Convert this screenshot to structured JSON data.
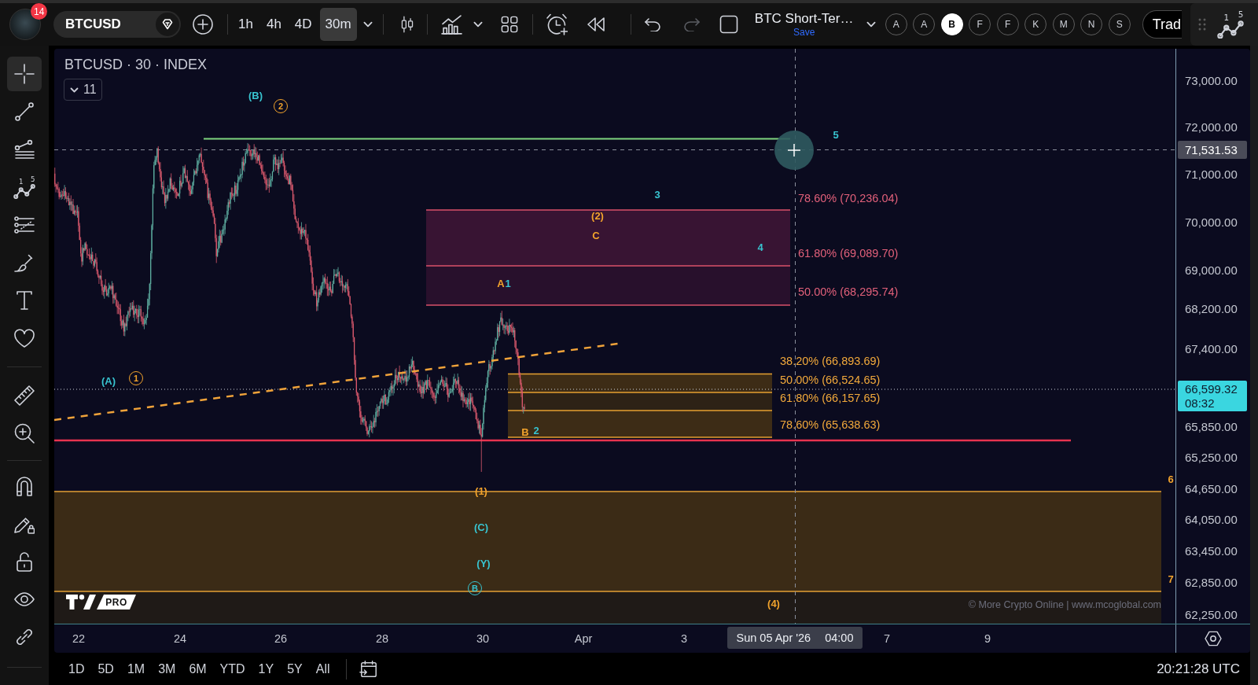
{
  "top_toolbar": {
    "notification_count": "14",
    "symbol": "BTCUSD",
    "intervals": [
      {
        "label": "1h",
        "selected": false
      },
      {
        "label": "4h",
        "selected": false
      },
      {
        "label": "4D",
        "selected": false
      },
      {
        "label": "30m",
        "selected": true
      }
    ],
    "history_buttons": [
      {
        "disabled": false
      },
      {
        "disabled": true
      }
    ],
    "layout_name": "BTC Short-Ter…",
    "save_label": "Save",
    "drawing_lists": [
      {
        "label": "A",
        "selected": false
      },
      {
        "label": "A",
        "selected": false
      },
      {
        "label": "B",
        "selected": true
      },
      {
        "label": "F",
        "selected": false
      },
      {
        "label": "F",
        "selected": false
      },
      {
        "label": "K",
        "selected": false
      },
      {
        "label": "M",
        "selected": false
      },
      {
        "label": "N",
        "selected": false
      },
      {
        "label": "S",
        "selected": false
      }
    ],
    "trade_button": "Trad",
    "wave_tool_digits": [
      "1",
      "5"
    ]
  },
  "left_toolbar": {
    "tools": [
      {
        "selected": true
      },
      {
        "selected": false
      },
      {
        "selected": false
      },
      {
        "selected": false,
        "digits": [
          "1",
          "5"
        ]
      },
      {
        "selected": false
      },
      {
        "selected": false
      },
      {
        "selected": false
      },
      {
        "selected": false
      },
      {
        "selected": false
      },
      {
        "selected": false
      },
      {
        "selected": false
      },
      {
        "selected": false
      },
      {
        "selected": false
      },
      {
        "selected": false
      },
      {
        "selected": false
      }
    ]
  },
  "chart": {
    "title": "BTCUSD · 30 · INDEX",
    "legend_count": "11",
    "fib_levels": [
      {
        "label": "78.60% (70,236.04)",
        "color": "#e2607a"
      },
      {
        "label": "61.80% (69,089.70)",
        "color": "#e2607a"
      },
      {
        "label": "50.00% (68,295.74)",
        "color": "#e2607a"
      },
      {
        "label": "38.20% (66,893.69)",
        "color": "#f2a93b"
      },
      {
        "label": "50.00% (66,524.65)",
        "color": "#f2a93b"
      },
      {
        "label": "61.80% (66,157.65)",
        "color": "#f2a93b"
      },
      {
        "label": "78.60% (65,638.63)",
        "color": "#f2a93b"
      }
    ],
    "wave_labels": [
      {
        "text": "(B)",
        "color": "#38c4d0",
        "circled": false
      },
      {
        "text": "2",
        "color": "#f2a32c",
        "circled": true
      },
      {
        "text": "5",
        "color": "#38c4d0",
        "circled": false
      },
      {
        "text": "3",
        "color": "#38c4d0",
        "circled": false
      },
      {
        "text": "(2)",
        "color": "#f2a32c",
        "circled": false
      },
      {
        "text": "C",
        "color": "#f2a32c",
        "circled": false
      },
      {
        "text": "4",
        "color": "#38c4d0",
        "circled": false
      },
      {
        "text": "A",
        "color": "#f2a32c",
        "circled": false
      },
      {
        "text": "1",
        "color": "#38c4d0",
        "circled": false
      },
      {
        "text": "(A)",
        "color": "#38c4d0",
        "circled": false
      },
      {
        "text": "1",
        "color": "#f2a32c",
        "circled": true
      },
      {
        "text": "B",
        "color": "#f2a32c",
        "circled": false
      },
      {
        "text": "2",
        "color": "#38c4d0",
        "circled": false
      },
      {
        "text": "6",
        "color": "#f2a32c",
        "circled": false
      },
      {
        "text": "(1)",
        "color": "#f2a32c",
        "circled": false
      },
      {
        "text": "(C)",
        "color": "#38c4d0",
        "circled": false
      },
      {
        "text": "(Y)",
        "color": "#38c4d0",
        "circled": false
      },
      {
        "text": "7",
        "color": "#f2a32c",
        "circled": false
      },
      {
        "text": "B",
        "color": "#38c4d0",
        "circled": true
      },
      {
        "text": "(4)",
        "color": "#f2a32c",
        "circled": false
      }
    ],
    "logo_badge": "PRO",
    "credit": "© More Crypto Online | www.mcoglobal.com",
    "price_axis": {
      "labels": [
        "73,000.00",
        "72,000.00",
        "71,000.00",
        "70,000.00",
        "69,000.00",
        "68,200.00",
        "67,400.00",
        "65,850.00",
        "65,250.00",
        "64,650.00",
        "64,050.00",
        "63,450.00",
        "62,850.00",
        "62,250.00"
      ],
      "crosshair_price": "71,531.53",
      "last_price": "66,599.32",
      "countdown": "08:32"
    },
    "time_axis": {
      "labels": [
        "22",
        "24",
        "26",
        "28",
        "30",
        "Apr",
        "3",
        "7",
        "9"
      ],
      "crosshair_date": "Sun 05 Apr '26",
      "crosshair_time": "04:00"
    }
  },
  "bottom_bar": {
    "ranges": [
      "1D",
      "5D",
      "1M",
      "3M",
      "6M",
      "YTD",
      "1Y",
      "5Y",
      "All"
    ],
    "clock": "20:21:28 UTC"
  }
}
